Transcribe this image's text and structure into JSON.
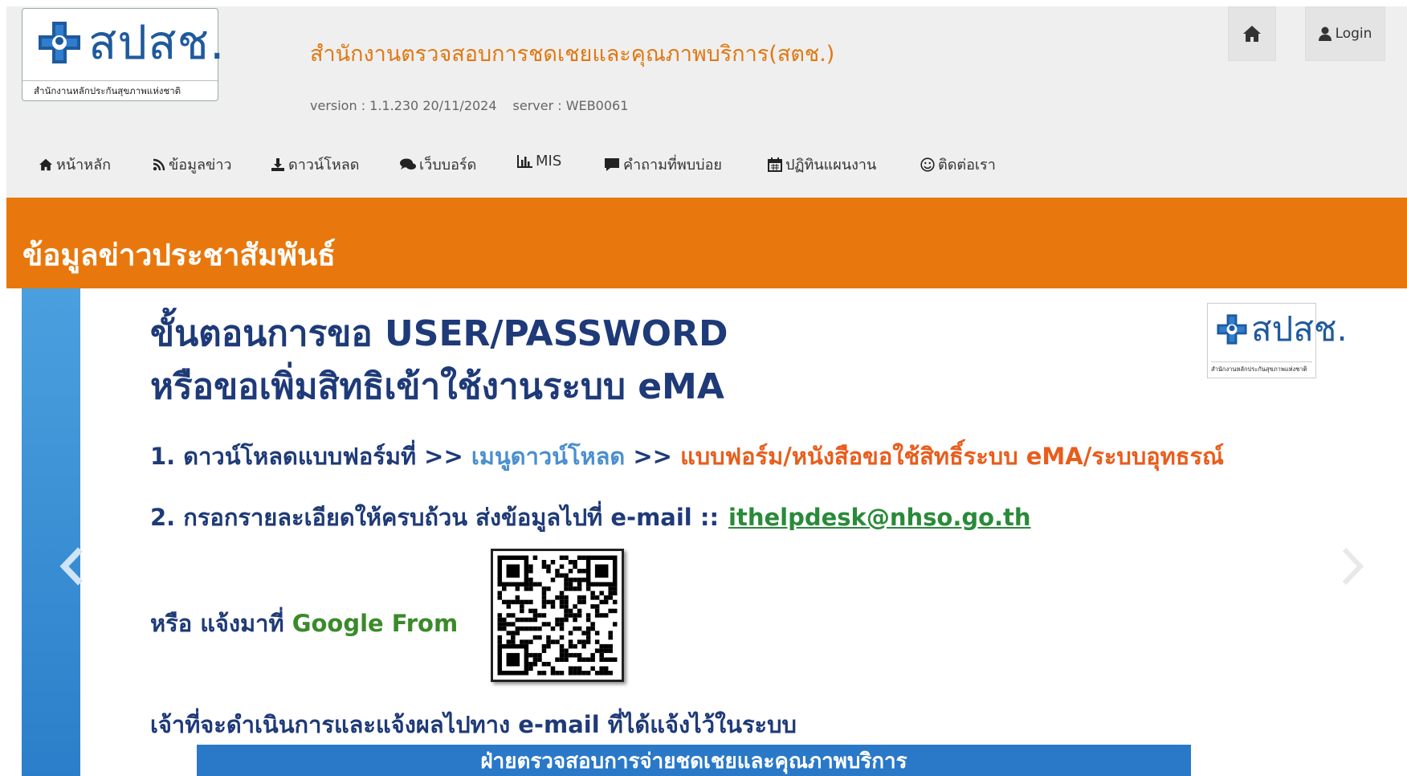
{
  "header": {
    "logo": {
      "brand": "สปสช.",
      "subtitle": "สำนักงานหลักประกันสุขภาพแห่งชาติ"
    },
    "title": "สำนักงานตรวจสอบการชดเชยและคุณภาพบริการ(สตช.)",
    "version": "version : 1.1.230 20/11/2024",
    "server": "server : WEB0061",
    "login_label": "Login"
  },
  "nav": [
    {
      "label": "หน้าหลัก",
      "icon": "home-icon"
    },
    {
      "label": "ข้อมูลข่าว",
      "icon": "rss-icon"
    },
    {
      "label": "ดาวน์โหลด",
      "icon": "download-icon"
    },
    {
      "label": "เว็บบอร์ด",
      "icon": "comments-icon"
    },
    {
      "label": "MIS",
      "icon": "bar-chart-icon"
    },
    {
      "label": "คำถามที่พบบ่อย",
      "icon": "comment-icon"
    },
    {
      "label": "ปฏิทินแผนงาน",
      "icon": "calendar-icon"
    },
    {
      "label": "ติดต่อเรา",
      "icon": "smile-icon"
    }
  ],
  "banner": {
    "title": "ข้อมูลข่าวประชาสัมพันธ์"
  },
  "slide": {
    "title_line1": "ขั้นตอนการขอ USER/PASSWORD",
    "title_line2": "หรือขอเพิ่มสิทธิเข้าใช้งานระบบ eMA",
    "logo_brand": "สปสช.",
    "logo_subtitle": "สำนักงานหลักประกันสุขภาพแห่งชาติ",
    "step1_prefix": "1. ดาวน์โหลดแบบฟอร์มที่ >>",
    "step1_menu": "เมนูดาวน์โหลด",
    "step1_sep": ">>",
    "step1_form": "แบบฟอร์ม/หนังสือขอใช้สิทธิ์ระบบ eMA/ระบบอุทธรณ์",
    "step2_prefix": "2. กรอกรายละเอียดให้ครบถ้วน ส่งข้อมูลไปที่ e-mail ::",
    "step2_email": "ithelpdesk@nhso.go.th",
    "or_prefix": "หรือ  แจ้งมาที่",
    "or_google": "Google From",
    "notice": "เจ้าที่จะดำเนินการและแจ้งผลไปทาง e-mail ที่ได้แจ้งไว้ในระบบ",
    "footer": "ฝ่ายตรวจสอบการจ่ายชดเชยและคุณภาพบริการ"
  },
  "colors": {
    "accent_orange": "#e8780d",
    "navy": "#1e3a78",
    "link_blue": "#4a8fcf"
  }
}
